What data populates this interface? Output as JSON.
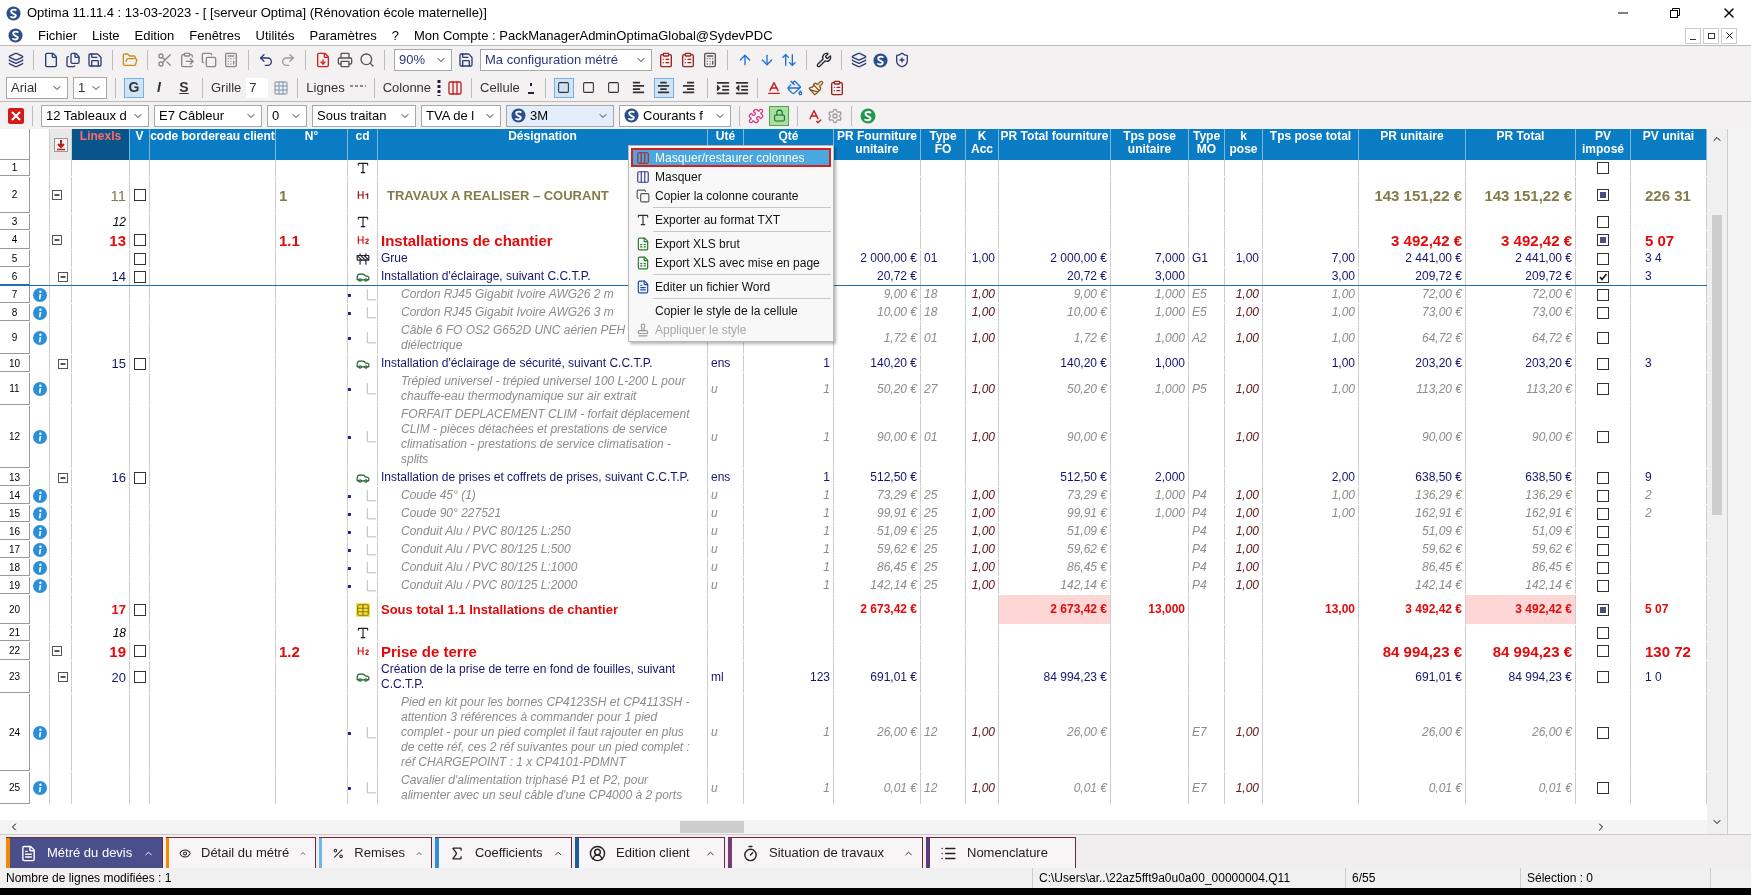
{
  "window": {
    "title": "Optima 11.11.4 : 13-03-2023 - [ [serveur Optima] (Rénovation école maternelle)]"
  },
  "menu": [
    "Fichier",
    "Liste",
    "Edition",
    "Fenêtres",
    "Utilités",
    "Paramètres",
    "?"
  ],
  "account": "Mon Compte : PackManagerAdminOptimaGlobal@SydevPDC",
  "toolbar": {
    "zoom": "90%",
    "configuration": "Ma configuration métré"
  },
  "format_bar": {
    "font": "Arial",
    "size": "1",
    "style_buttons": [
      {
        "label": "G",
        "pressed": true
      },
      {
        "label": "I",
        "pressed": false
      },
      {
        "label": "S",
        "pressed": false
      }
    ],
    "grid_label": "Grille",
    "grid_value": "7",
    "lines_label": "Lignes",
    "column_label": "Colonne",
    "cell_label": "Cellule",
    "toggles": [
      {
        "pressed": true
      },
      {
        "pressed": false
      },
      {
        "pressed": false
      },
      {
        "pressed": false
      },
      {
        "pressed": true
      },
      {
        "pressed": false
      }
    ]
  },
  "filter_bar": {
    "dropdowns": [
      "12 Tableaux d",
      "E7 Câbleur",
      "0",
      "Sous traitan",
      "TVA de l"
    ],
    "brand_dropdowns": [
      "3M",
      "Courants f"
    ],
    "lock_pressed": true
  },
  "table": {
    "columns": [
      {
        "label": "Linexls",
        "highlight": true
      },
      {
        "label": "V",
        "highlight": false
      },
      {
        "label": "code bordereau client",
        "highlight": false
      },
      {
        "label": "N°",
        "highlight": false
      },
      {
        "label": "cd",
        "highlight": false
      },
      {
        "label": "Désignation",
        "highlight": false
      },
      {
        "label": "Uté",
        "highlight": false
      },
      {
        "label": "Qté",
        "highlight": false
      },
      {
        "label": "PR Fourniture unitaire",
        "highlight": false
      },
      {
        "label": "Type FO",
        "highlight": false
      },
      {
        "label": "K Acc",
        "highlight": false
      },
      {
        "label": "PR Total fourniture",
        "highlight": false
      },
      {
        "label": "Tps pose unitaire",
        "highlight": false
      },
      {
        "label": "Type MO",
        "highlight": false
      },
      {
        "label": "k pose",
        "highlight": false
      },
      {
        "label": "Tps pose total",
        "highlight": false
      },
      {
        "label": "PR unitaire",
        "highlight": false
      },
      {
        "label": "PR Total",
        "highlight": false
      },
      {
        "label": "PV imposé",
        "highlight": false
      },
      {
        "label": "PV unitai",
        "highlight": false
      }
    ],
    "rows": [
      {
        "n": "1",
        "kind": "text",
        "selected": false,
        "cd": {
          "kind": "text"
        },
        "pv_checked": false,
        "pv_partial": false
      },
      {
        "n": "2",
        "kind": "title",
        "selected": false,
        "expanded": true,
        "linexls": "11",
        "v_checked": false,
        "number": "1",
        "cd": {
          "kind": "title1"
        },
        "designation": "TRAVAUX A REALISER – COURANT",
        "pr_unit": "143 151,22 €",
        "pr_total": "143 151,22 €",
        "pv_checked": false,
        "pv_partial": true,
        "pv_unit": "226 31"
      },
      {
        "n": "3",
        "kind": "text",
        "selected": false,
        "linexls": "12",
        "cd": {
          "kind": "text"
        },
        "pv_checked": false,
        "pv_partial": false
      },
      {
        "n": "4",
        "kind": "chapter",
        "selected": false,
        "expanded": true,
        "linexls": "13",
        "v_checked": false,
        "number": "1.1",
        "cd": {
          "kind": "title2"
        },
        "designation": "Installations de chantier",
        "pr_unit": "3 492,42 €",
        "pr_total": "3 492,42 €",
        "pv_checked": false,
        "pv_partial": true,
        "pv_unit": "5 07"
      },
      {
        "n": "5",
        "kind": "article",
        "selected": false,
        "v_checked": false,
        "cd": {
          "kind": "simple"
        },
        "designation": "Grue",
        "pr_supply_unit": "2 000,00 €",
        "supply_type": "01",
        "k_acc": "1,00",
        "pr_supply_total": "2 000,00 €",
        "labour_time_unit": "7,000",
        "labour_type": "G1",
        "k_labour": "1,00",
        "labour_time_total": "7,00",
        "pr_unit": "2 441,00 €",
        "pr_total": "2 441,00 €",
        "pv_checked": false,
        "pv_partial": false,
        "pv_unit": "3 4"
      },
      {
        "n": "6",
        "kind": "article",
        "selected": true,
        "expanded": true,
        "linexls": "14",
        "v_checked": false,
        "cd": {
          "kind": "article"
        },
        "designation": "Installation d'éclairage, suivant C.C.T.P.",
        "pr_supply_unit": "20,72 €",
        "pr_supply_total": "20,72 €",
        "labour_time_unit": "3,000",
        "labour_time_total": "3,00",
        "pr_unit": "209,72 €",
        "pr_total": "209,72 €",
        "pv_checked": true,
        "pv_partial": false,
        "pv_unit": "3"
      },
      {
        "n": "7",
        "kind": "detail",
        "selected": false,
        "designation": "Cordon RJ45 Gigabit Ivoire AWG26 2 m",
        "pr_supply_unit": "9,00 €",
        "supply_type": "18",
        "k_acc": "1,00",
        "pr_supply_total": "9,00 €",
        "labour_time_unit": "1,000",
        "labour_type": "E5",
        "k_labour": "1,00",
        "labour_time_total": "1,00",
        "pr_unit": "72,00 €",
        "pr_total": "72,00 €",
        "pv_checked": false,
        "pv_partial": false
      },
      {
        "n": "8",
        "kind": "detail",
        "selected": false,
        "designation": "Cordon RJ45 Gigabit Ivoire AWG26 3 m",
        "pr_supply_unit": "10,00 €",
        "supply_type": "18",
        "k_acc": "1,00",
        "pr_supply_total": "10,00 €",
        "labour_time_unit": "1,000",
        "labour_type": "E5",
        "k_labour": "1,00",
        "labour_time_total": "1,00",
        "pr_unit": "73,00 €",
        "pr_total": "73,00 €",
        "pv_checked": false,
        "pv_partial": false
      },
      {
        "n": "9",
        "kind": "detail",
        "selected": false,
        "designation": "Câble 6 FO OS2 G652D UNC aérien PEH\ndiélectrique",
        "pr_supply_unit": "1,72 €",
        "supply_type": "01",
        "k_acc": "1,00",
        "pr_supply_total": "1,72 €",
        "labour_time_unit": "1,000",
        "labour_type": "A2",
        "k_labour": "1,00",
        "labour_time_total": "1,00",
        "pr_unit": "64,72 €",
        "pr_total": "64,72 €",
        "pv_checked": false,
        "pv_partial": false
      },
      {
        "n": "10",
        "kind": "article",
        "selected": false,
        "expanded": true,
        "linexls": "15",
        "v_checked": false,
        "cd": {
          "kind": "article"
        },
        "designation": "Installation d'éclairage de sécurité, suivant C.C.T.P.",
        "unit": "ens",
        "qty": "1",
        "pr_supply_unit": "140,20 €",
        "pr_supply_total": "140,20 €",
        "labour_time_unit": "1,000",
        "labour_time_total": "1,00",
        "pr_unit": "203,20 €",
        "pr_total": "203,20 €",
        "pv_checked": false,
        "pv_partial": false,
        "pv_unit": "3"
      },
      {
        "n": "11",
        "kind": "detail",
        "selected": false,
        "designation": "Trépied universel - trépied universel 100 L-200 L pour chauffe-eau thermodynamique sur air extrait",
        "unit": "u",
        "qty": "1",
        "pr_supply_unit": "50,20 €",
        "supply_type": "27",
        "k_acc": "1,00",
        "pr_supply_total": "50,20 €",
        "labour_time_unit": "1,000",
        "labour_type": "P5",
        "k_labour": "1,00",
        "labour_time_total": "1,00",
        "pr_unit": "113,20 €",
        "pr_total": "113,20 €",
        "pv_checked": false,
        "pv_partial": false
      },
      {
        "n": "12",
        "kind": "detail",
        "selected": false,
        "designation": "FORFAIT DEPLACEMENT CLIM - forfait déplacement CLIM - pièces détachées et prestations de service climatisation - prestations de service climatisation - splits",
        "unit": "u",
        "qty": "1",
        "pr_supply_unit": "90,00 €",
        "supply_type": "01",
        "k_acc": "1,00",
        "pr_supply_total": "90,00 €",
        "k_labour": "1,00",
        "pr_unit": "90,00 €",
        "pr_total": "90,00 €",
        "pv_checked": false,
        "pv_partial": false
      },
      {
        "n": "13",
        "kind": "article",
        "selected": false,
        "expanded": true,
        "linexls": "16",
        "v_checked": false,
        "cd": {
          "kind": "article"
        },
        "designation": "Installation de prises et coffrets de prises, suivant C.C.T.P.",
        "unit": "ens",
        "qty": "1",
        "pr_supply_unit": "512,50 €",
        "pr_supply_total": "512,50 €",
        "labour_time_unit": "2,000",
        "labour_time_total": "2,00",
        "pr_unit": "638,50 €",
        "pr_total": "638,50 €",
        "pv_checked": false,
        "pv_partial": false,
        "pv_unit": "9"
      },
      {
        "n": "14",
        "kind": "detail",
        "selected": false,
        "designation": "Coude 45° (1)",
        "unit": "u",
        "qty": "1",
        "pr_supply_unit": "73,29 €",
        "supply_type": "25",
        "k_acc": "1,00",
        "pr_supply_total": "73,29 €",
        "labour_time_unit": "1,000",
        "labour_type": "P4",
        "k_labour": "1,00",
        "labour_time_total": "1,00",
        "pr_unit": "136,29 €",
        "pr_total": "136,29 €",
        "pv_checked": false,
        "pv_partial": false,
        "pv_unit": "2"
      },
      {
        "n": "15",
        "kind": "detail",
        "selected": false,
        "designation": "Coude 90° 227521",
        "unit": "u",
        "qty": "1",
        "pr_supply_unit": "99,91 €",
        "supply_type": "25",
        "k_acc": "1,00",
        "pr_supply_total": "99,91 €",
        "labour_time_unit": "1,000",
        "labour_type": "P4",
        "k_labour": "1,00",
        "labour_time_total": "1,00",
        "pr_unit": "162,91 €",
        "pr_total": "162,91 €",
        "pv_checked": false,
        "pv_partial": false,
        "pv_unit": "2"
      },
      {
        "n": "16",
        "kind": "detail",
        "selected": false,
        "designation": "Conduit Alu / PVC 80/125 L:250",
        "unit": "u",
        "qty": "1",
        "pr_supply_unit": "51,09 €",
        "supply_type": "25",
        "k_acc": "1,00",
        "pr_supply_total": "51,09 €",
        "labour_type": "P4",
        "k_labour": "1,00",
        "pr_unit": "51,09 €",
        "pr_total": "51,09 €",
        "pv_checked": false,
        "pv_partial": false
      },
      {
        "n": "17",
        "kind": "detail",
        "selected": false,
        "designation": "Conduit Alu / PVC 80/125 L:500",
        "unit": "u",
        "qty": "1",
        "pr_supply_unit": "59,62 €",
        "supply_type": "25",
        "k_acc": "1,00",
        "pr_supply_total": "59,62 €",
        "labour_type": "P4",
        "k_labour": "1,00",
        "pr_unit": "59,62 €",
        "pr_total": "59,62 €",
        "pv_checked": false,
        "pv_partial": false
      },
      {
        "n": "18",
        "kind": "detail",
        "selected": false,
        "designation": "Conduit Alu / PVC 80/125 L:1000",
        "unit": "u",
        "qty": "1",
        "pr_supply_unit": "86,45 €",
        "supply_type": "25",
        "k_acc": "1,00",
        "pr_supply_total": "86,45 €",
        "labour_type": "P4",
        "k_labour": "1,00",
        "pr_unit": "86,45 €",
        "pr_total": "86,45 €",
        "pv_checked": false,
        "pv_partial": false
      },
      {
        "n": "19",
        "kind": "detail",
        "selected": false,
        "designation": "Conduit Alu / PVC 80/125 L:2000",
        "unit": "u",
        "qty": "1",
        "pr_supply_unit": "142,14 €",
        "supply_type": "25",
        "k_acc": "1,00",
        "pr_supply_total": "142,14 €",
        "labour_type": "P4",
        "k_labour": "1,00",
        "pr_unit": "142,14 €",
        "pr_total": "142,14 €",
        "pv_checked": false,
        "pv_partial": false
      },
      {
        "n": "20",
        "kind": "subtotal",
        "selected": false,
        "highlighted_totals": true,
        "linexls": "17",
        "v_checked": false,
        "cd": {
          "kind": "subtotal"
        },
        "designation": "Sous total 1.1 Installations de chantier",
        "pr_supply_unit": "2 673,42 €",
        "pr_supply_total": "2 673,42 €",
        "labour_time_unit": "13,000",
        "labour_time_total": "13,00",
        "pr_unit": "3 492,42 €",
        "pr_total": "3 492,42 €",
        "pv_checked": false,
        "pv_partial": true,
        "pv_unit": "5 07"
      },
      {
        "n": "21",
        "kind": "text",
        "selected": false,
        "linexls": "18",
        "cd": {
          "kind": "text"
        },
        "pv_checked": false,
        "pv_partial": false
      },
      {
        "n": "22",
        "kind": "chapter",
        "selected": false,
        "expanded": true,
        "linexls": "19",
        "v_checked": false,
        "number": "1.2",
        "cd": {
          "kind": "title2"
        },
        "designation": "Prise de terre",
        "pr_unit": "84 994,23 €",
        "pr_total": "84 994,23 €",
        "pv_checked": false,
        "pv_partial": false,
        "pv_unit": "130 72"
      },
      {
        "n": "23",
        "kind": "article",
        "selected": false,
        "expanded": true,
        "linexls": "20",
        "v_checked": false,
        "cd": {
          "kind": "article"
        },
        "designation": "Création de la prise de terre en fond de fouilles, suivant C.C.T.P.",
        "unit": "ml",
        "qty": "123",
        "pr_supply_unit": "691,01 €",
        "pr_supply_total": "84 994,23 €",
        "pr_unit": "691,01 €",
        "pr_total": "84 994,23 €",
        "pv_checked": false,
        "pv_partial": false,
        "pv_unit": "1 0"
      },
      {
        "n": "24",
        "kind": "detail",
        "selected": false,
        "designation": "Pied en kit pour les bornes CP4123SH et CP4113SH - attention 3 références à commander pour 1 pied complet - pour un pied complet il faut rajouter en plus de cette réf, ces 2 réf suivantes pour un pied complet : réf CHARGEPOINT : 1 x CP4101-PDMNT",
        "unit": "u",
        "qty": "1",
        "pr_supply_unit": "26,00 €",
        "supply_type": "12",
        "k_acc": "1,00",
        "pr_supply_total": "26,00 €",
        "labour_type": "E7",
        "k_labour": "1,00",
        "pr_unit": "26,00 €",
        "pr_total": "26,00 €",
        "pv_checked": false,
        "pv_partial": false
      },
      {
        "n": "25",
        "kind": "detail",
        "selected": false,
        "designation": "Cavalier d'alimentation triphasé P1 et P2, pour alimenter avec un seul câble d'une CP4000 à 2 ports",
        "unit": "u",
        "qty": "1",
        "pr_supply_unit": "0,01 €",
        "supply_type": "12",
        "k_acc": "1,00",
        "pr_supply_total": "0,01 €",
        "labour_type": "E7",
        "k_labour": "1,00",
        "pr_unit": "0,01 €",
        "pr_total": "0,01 €",
        "pv_checked": false,
        "pv_partial": false
      }
    ]
  },
  "context_menu": {
    "items": [
      {
        "label": "Masquer/restaurer colonnes",
        "selected": true,
        "disabled": false,
        "separator_before": false
      },
      {
        "label": "Masquer",
        "selected": false,
        "disabled": false,
        "separator_before": false
      },
      {
        "label": "Copier la colonne courante",
        "selected": false,
        "disabled": false,
        "separator_before": false
      },
      {
        "label": "Exporter au format TXT",
        "selected": false,
        "disabled": false,
        "separator_before": true
      },
      {
        "label": "Export XLS brut",
        "selected": false,
        "disabled": false,
        "separator_before": true
      },
      {
        "label": "Export XLS avec mise en page",
        "selected": false,
        "disabled": false,
        "separator_before": false
      },
      {
        "label": "Editer un fichier Word",
        "selected": false,
        "disabled": false,
        "separator_before": true
      },
      {
        "label": "Copier le style de la cellule",
        "selected": false,
        "disabled": false,
        "separator_before": true
      },
      {
        "label": "Appliquer le style",
        "selected": false,
        "disabled": true,
        "separator_before": false
      }
    ]
  },
  "bottom_tabs": [
    {
      "label": "Métré du devis",
      "selected": true,
      "color": "#f08a00"
    },
    {
      "label": "Détail du métré",
      "selected": false,
      "color": "#f08a00"
    },
    {
      "label": "Remises",
      "selected": false,
      "color": "#6db8e6"
    },
    {
      "label": "Coefficients",
      "selected": false,
      "color": "#2f8fd8"
    },
    {
      "label": "Edition client",
      "selected": false,
      "color": "#1c5c9c"
    },
    {
      "label": "Situation de travaux",
      "selected": false,
      "color": "#7a3a7a"
    },
    {
      "label": "Nomenclature",
      "selected": false,
      "color": "#5a3a7a"
    }
  ],
  "status_bar": [
    "Nombre de lignes modifiées : 1",
    "C:\\Users\\ar..\\22az5fft9a0u0a00_00000004.Q11",
    "6/55",
    "Sélection : 0"
  ]
}
